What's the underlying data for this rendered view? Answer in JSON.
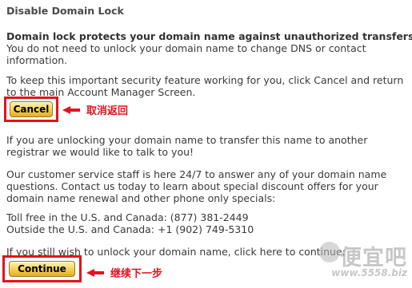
{
  "page": {
    "title": "Disable Domain Lock",
    "intro_bold": "Domain lock protects your domain name against unauthorized transfers.",
    "intro_lines": [
      "You do not need to unlock your domain name to change DNS or contact",
      "information."
    ],
    "keep_lines": [
      "To keep this important security feature working for you, click Cancel and return",
      "to the main Account Manager Screen."
    ],
    "transfer_lines": [
      "If you are unlocking your domain name to transfer this name to another",
      "registrar we would like to talk to you!"
    ],
    "service_lines": [
      "Our customer service staff is here 24/7 to answer any of your domain name",
      "questions. Contact us today to learn about special discount offers for your",
      "domain name renewal and other phone only specials:"
    ],
    "phone_lines": [
      "Toll free in the U.S. and Canada: (877) 381-2449",
      "Outside the U.S. and Canada: +1 (902) 749-5310"
    ],
    "still_line": "If you still wish to unlock your domain name, click here to continue:"
  },
  "buttons": {
    "cancel_label": "Cancel",
    "continue_label": "Continue"
  },
  "annotations": {
    "cancel_note": "取消返回",
    "continue_note": "继续下一步",
    "color": "#e3121e"
  },
  "watermark": {
    "logo_text": "便宜吧",
    "url": "www.5558.biz"
  }
}
